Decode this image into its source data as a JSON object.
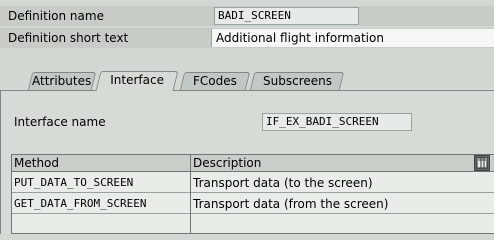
{
  "definition": {
    "name_label": "Definition name",
    "name_value": "BADI_SCREEN",
    "short_text_label": "Definition short text",
    "short_text_value": "Additional flight information"
  },
  "tabs": [
    {
      "label": "Attributes",
      "active": false
    },
    {
      "label": "Interface",
      "active": true
    },
    {
      "label": "FCodes",
      "active": false
    },
    {
      "label": "Subscreens",
      "active": false
    }
  ],
  "interface": {
    "label": "Interface name",
    "value": "IF_EX_BADI_SCREEN"
  },
  "table": {
    "columns": [
      "Method",
      "Description"
    ],
    "rows": [
      {
        "method": "PUT_DATA_TO_SCREEN",
        "description": "Transport data (to the screen)"
      },
      {
        "method": "GET_DATA_FROM_SCREEN",
        "description": "Transport data (from the screen)"
      }
    ],
    "settings_icon": "table-settings-icon"
  }
}
